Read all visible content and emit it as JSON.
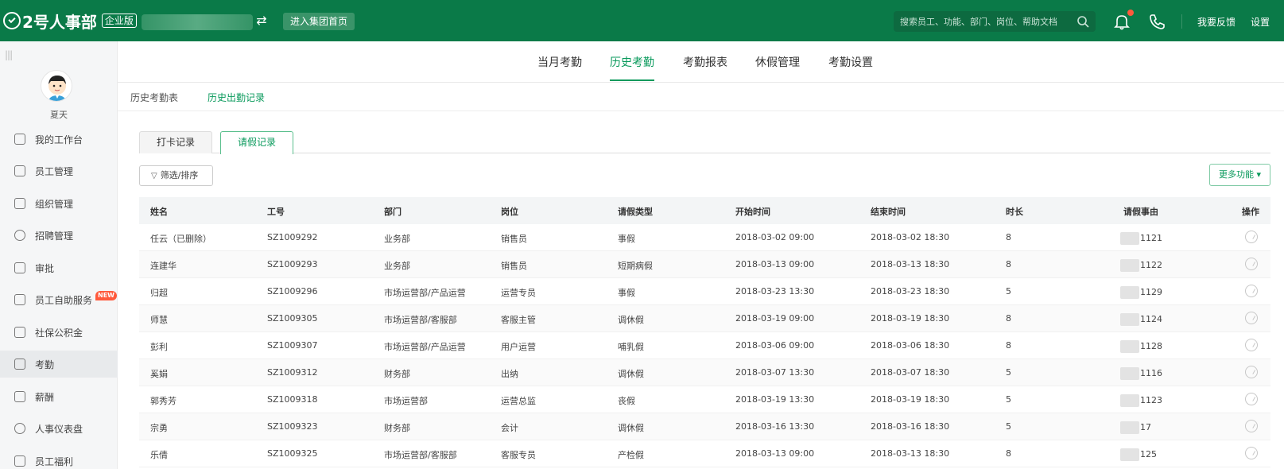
{
  "header": {
    "logo_text": "2号人事部",
    "edition": "企业版",
    "group_button": "进入集团首页",
    "search_placeholder": "搜索员工、功能、部门、岗位、帮助文档",
    "feedback": "我要反馈",
    "settings": "设置"
  },
  "sidebar": {
    "username": "夏天",
    "items": [
      {
        "label": "我的工作台"
      },
      {
        "label": "员工管理"
      },
      {
        "label": "组织管理"
      },
      {
        "label": "招聘管理"
      },
      {
        "label": "审批"
      },
      {
        "label": "员工自助服务",
        "badge": "NEW"
      },
      {
        "label": "社保公积金"
      },
      {
        "label": "考勤"
      },
      {
        "label": "薪酬"
      },
      {
        "label": "人事仪表盘"
      },
      {
        "label": "员工福利"
      }
    ]
  },
  "main_tabs": [
    "当月考勤",
    "历史考勤",
    "考勤报表",
    "休假管理",
    "考勤设置"
  ],
  "sub_tabs": [
    "历史考勤表",
    "历史出勤记录"
  ],
  "record_tabs": [
    "打卡记录",
    "请假记录"
  ],
  "toolbar": {
    "filter": "筛选/排序",
    "more": "更多功能"
  },
  "table": {
    "headers": [
      "姓名",
      "工号",
      "部门",
      "岗位",
      "请假类型",
      "开始时间",
      "结束时间",
      "时长",
      "请假事由",
      "操作"
    ],
    "rows": [
      [
        "任云（已删除）",
        "SZ1009292",
        "业务部",
        "销售员",
        "事假",
        "2018-03-02 09:00",
        "2018-03-02 18:30",
        "8",
        "1121"
      ],
      [
        "连建华",
        "SZ1009293",
        "业务部",
        "销售员",
        "短期病假",
        "2018-03-13 09:00",
        "2018-03-13 18:30",
        "8",
        "1122"
      ],
      [
        "归超",
        "SZ1009296",
        "市场运营部/产品运营",
        "运营专员",
        "事假",
        "2018-03-23 13:30",
        "2018-03-23 18:30",
        "5",
        "1129"
      ],
      [
        "师慧",
        "SZ1009305",
        "市场运营部/客服部",
        "客服主管",
        "调休假",
        "2018-03-19 09:00",
        "2018-03-19 18:30",
        "8",
        "1124"
      ],
      [
        "彭利",
        "SZ1009307",
        "市场运营部/产品运营",
        "用户运营",
        "哺乳假",
        "2018-03-06 09:00",
        "2018-03-06 18:30",
        "8",
        "1128"
      ],
      [
        "奚娟",
        "SZ1009312",
        "财务部",
        "出纳",
        "调休假",
        "2018-03-07 13:30",
        "2018-03-07 18:30",
        "5",
        "1116"
      ],
      [
        "郭秀芳",
        "SZ1009318",
        "市场运营部",
        "运营总监",
        "丧假",
        "2018-03-19 13:30",
        "2018-03-19 18:30",
        "5",
        "1123"
      ],
      [
        "宗勇",
        "SZ1009323",
        "财务部",
        "会计",
        "调休假",
        "2018-03-16 13:30",
        "2018-03-16 18:30",
        "5",
        "17"
      ],
      [
        "乐倩",
        "SZ1009325",
        "市场运营部/客服部",
        "客服专员",
        "产检假",
        "2018-03-13 09:00",
        "2018-03-13 18:30",
        "8",
        "125"
      ]
    ]
  }
}
